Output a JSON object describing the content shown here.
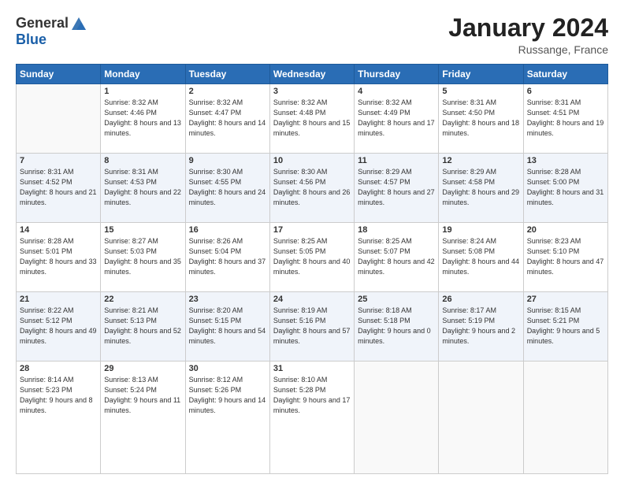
{
  "header": {
    "logo_general": "General",
    "logo_blue": "Blue",
    "month_title": "January 2024",
    "location": "Russange, France"
  },
  "days_of_week": [
    "Sunday",
    "Monday",
    "Tuesday",
    "Wednesday",
    "Thursday",
    "Friday",
    "Saturday"
  ],
  "weeks": [
    [
      {
        "day": "",
        "sunrise": "",
        "sunset": "",
        "daylight": ""
      },
      {
        "day": "1",
        "sunrise": "Sunrise: 8:32 AM",
        "sunset": "Sunset: 4:46 PM",
        "daylight": "Daylight: 8 hours and 13 minutes."
      },
      {
        "day": "2",
        "sunrise": "Sunrise: 8:32 AM",
        "sunset": "Sunset: 4:47 PM",
        "daylight": "Daylight: 8 hours and 14 minutes."
      },
      {
        "day": "3",
        "sunrise": "Sunrise: 8:32 AM",
        "sunset": "Sunset: 4:48 PM",
        "daylight": "Daylight: 8 hours and 15 minutes."
      },
      {
        "day": "4",
        "sunrise": "Sunrise: 8:32 AM",
        "sunset": "Sunset: 4:49 PM",
        "daylight": "Daylight: 8 hours and 17 minutes."
      },
      {
        "day": "5",
        "sunrise": "Sunrise: 8:31 AM",
        "sunset": "Sunset: 4:50 PM",
        "daylight": "Daylight: 8 hours and 18 minutes."
      },
      {
        "day": "6",
        "sunrise": "Sunrise: 8:31 AM",
        "sunset": "Sunset: 4:51 PM",
        "daylight": "Daylight: 8 hours and 19 minutes."
      }
    ],
    [
      {
        "day": "7",
        "sunrise": "Sunrise: 8:31 AM",
        "sunset": "Sunset: 4:52 PM",
        "daylight": "Daylight: 8 hours and 21 minutes."
      },
      {
        "day": "8",
        "sunrise": "Sunrise: 8:31 AM",
        "sunset": "Sunset: 4:53 PM",
        "daylight": "Daylight: 8 hours and 22 minutes."
      },
      {
        "day": "9",
        "sunrise": "Sunrise: 8:30 AM",
        "sunset": "Sunset: 4:55 PM",
        "daylight": "Daylight: 8 hours and 24 minutes."
      },
      {
        "day": "10",
        "sunrise": "Sunrise: 8:30 AM",
        "sunset": "Sunset: 4:56 PM",
        "daylight": "Daylight: 8 hours and 26 minutes."
      },
      {
        "day": "11",
        "sunrise": "Sunrise: 8:29 AM",
        "sunset": "Sunset: 4:57 PM",
        "daylight": "Daylight: 8 hours and 27 minutes."
      },
      {
        "day": "12",
        "sunrise": "Sunrise: 8:29 AM",
        "sunset": "Sunset: 4:58 PM",
        "daylight": "Daylight: 8 hours and 29 minutes."
      },
      {
        "day": "13",
        "sunrise": "Sunrise: 8:28 AM",
        "sunset": "Sunset: 5:00 PM",
        "daylight": "Daylight: 8 hours and 31 minutes."
      }
    ],
    [
      {
        "day": "14",
        "sunrise": "Sunrise: 8:28 AM",
        "sunset": "Sunset: 5:01 PM",
        "daylight": "Daylight: 8 hours and 33 minutes."
      },
      {
        "day": "15",
        "sunrise": "Sunrise: 8:27 AM",
        "sunset": "Sunset: 5:03 PM",
        "daylight": "Daylight: 8 hours and 35 minutes."
      },
      {
        "day": "16",
        "sunrise": "Sunrise: 8:26 AM",
        "sunset": "Sunset: 5:04 PM",
        "daylight": "Daylight: 8 hours and 37 minutes."
      },
      {
        "day": "17",
        "sunrise": "Sunrise: 8:25 AM",
        "sunset": "Sunset: 5:05 PM",
        "daylight": "Daylight: 8 hours and 40 minutes."
      },
      {
        "day": "18",
        "sunrise": "Sunrise: 8:25 AM",
        "sunset": "Sunset: 5:07 PM",
        "daylight": "Daylight: 8 hours and 42 minutes."
      },
      {
        "day": "19",
        "sunrise": "Sunrise: 8:24 AM",
        "sunset": "Sunset: 5:08 PM",
        "daylight": "Daylight: 8 hours and 44 minutes."
      },
      {
        "day": "20",
        "sunrise": "Sunrise: 8:23 AM",
        "sunset": "Sunset: 5:10 PM",
        "daylight": "Daylight: 8 hours and 47 minutes."
      }
    ],
    [
      {
        "day": "21",
        "sunrise": "Sunrise: 8:22 AM",
        "sunset": "Sunset: 5:12 PM",
        "daylight": "Daylight: 8 hours and 49 minutes."
      },
      {
        "day": "22",
        "sunrise": "Sunrise: 8:21 AM",
        "sunset": "Sunset: 5:13 PM",
        "daylight": "Daylight: 8 hours and 52 minutes."
      },
      {
        "day": "23",
        "sunrise": "Sunrise: 8:20 AM",
        "sunset": "Sunset: 5:15 PM",
        "daylight": "Daylight: 8 hours and 54 minutes."
      },
      {
        "day": "24",
        "sunrise": "Sunrise: 8:19 AM",
        "sunset": "Sunset: 5:16 PM",
        "daylight": "Daylight: 8 hours and 57 minutes."
      },
      {
        "day": "25",
        "sunrise": "Sunrise: 8:18 AM",
        "sunset": "Sunset: 5:18 PM",
        "daylight": "Daylight: 9 hours and 0 minutes."
      },
      {
        "day": "26",
        "sunrise": "Sunrise: 8:17 AM",
        "sunset": "Sunset: 5:19 PM",
        "daylight": "Daylight: 9 hours and 2 minutes."
      },
      {
        "day": "27",
        "sunrise": "Sunrise: 8:15 AM",
        "sunset": "Sunset: 5:21 PM",
        "daylight": "Daylight: 9 hours and 5 minutes."
      }
    ],
    [
      {
        "day": "28",
        "sunrise": "Sunrise: 8:14 AM",
        "sunset": "Sunset: 5:23 PM",
        "daylight": "Daylight: 9 hours and 8 minutes."
      },
      {
        "day": "29",
        "sunrise": "Sunrise: 8:13 AM",
        "sunset": "Sunset: 5:24 PM",
        "daylight": "Daylight: 9 hours and 11 minutes."
      },
      {
        "day": "30",
        "sunrise": "Sunrise: 8:12 AM",
        "sunset": "Sunset: 5:26 PM",
        "daylight": "Daylight: 9 hours and 14 minutes."
      },
      {
        "day": "31",
        "sunrise": "Sunrise: 8:10 AM",
        "sunset": "Sunset: 5:28 PM",
        "daylight": "Daylight: 9 hours and 17 minutes."
      },
      {
        "day": "",
        "sunrise": "",
        "sunset": "",
        "daylight": ""
      },
      {
        "day": "",
        "sunrise": "",
        "sunset": "",
        "daylight": ""
      },
      {
        "day": "",
        "sunrise": "",
        "sunset": "",
        "daylight": ""
      }
    ]
  ]
}
